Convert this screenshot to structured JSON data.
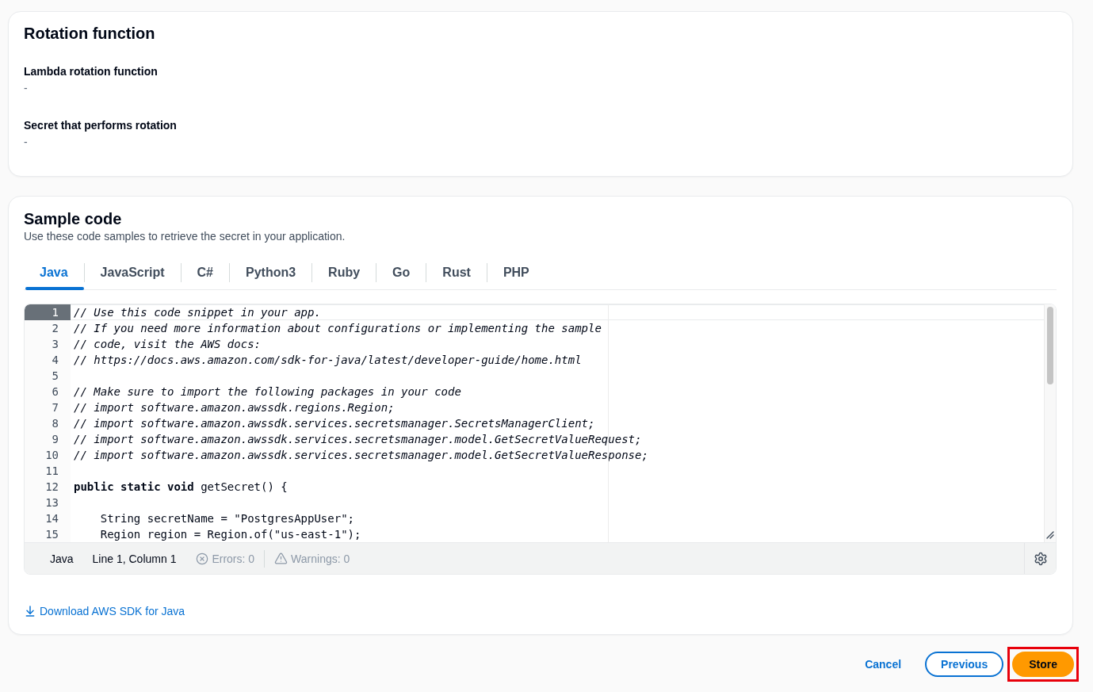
{
  "rotation_function": {
    "title": "Rotation function",
    "fields": [
      {
        "label": "Lambda rotation function",
        "value": "-"
      },
      {
        "label": "Secret that performs rotation",
        "value": "-"
      }
    ]
  },
  "sample_code": {
    "title": "Sample code",
    "description": "Use these code samples to retrieve the secret in your application.",
    "tabs": [
      {
        "label": "Java",
        "selected": true
      },
      {
        "label": "JavaScript",
        "selected": false
      },
      {
        "label": "C#",
        "selected": false
      },
      {
        "label": "Python3",
        "selected": false
      },
      {
        "label": "Ruby",
        "selected": false
      },
      {
        "label": "Go",
        "selected": false
      },
      {
        "label": "Rust",
        "selected": false
      },
      {
        "label": "PHP",
        "selected": false
      }
    ],
    "editor": {
      "lines": [
        {
          "number": "1",
          "kind": "comment",
          "text": "// Use this code snippet in your app.",
          "active": true
        },
        {
          "number": "2",
          "kind": "comment",
          "text": "// If you need more information about configurations or implementing the sample",
          "active": false
        },
        {
          "number": "3",
          "kind": "comment",
          "text": "// code, visit the AWS docs:",
          "active": false
        },
        {
          "number": "4",
          "kind": "comment",
          "text": "// https://docs.aws.amazon.com/sdk-for-java/latest/developer-guide/home.html",
          "active": false
        },
        {
          "number": "5",
          "kind": "blank",
          "active": false
        },
        {
          "number": "6",
          "kind": "comment",
          "text": "// Make sure to import the following packages in your code",
          "active": false
        },
        {
          "number": "7",
          "kind": "comment",
          "text": "// import software.amazon.awssdk.regions.Region;",
          "active": false
        },
        {
          "number": "8",
          "kind": "comment",
          "text": "// import software.amazon.awssdk.services.secretsmanager.SecretsManagerClient;",
          "active": false
        },
        {
          "number": "9",
          "kind": "comment",
          "text": "// import software.amazon.awssdk.services.secretsmanager.model.GetSecretValueRequest;",
          "active": false
        },
        {
          "number": "10",
          "kind": "comment",
          "text": "// import software.amazon.awssdk.services.secretsmanager.model.GetSecretValueResponse;",
          "active": false
        },
        {
          "number": "11",
          "kind": "blank",
          "active": false
        },
        {
          "number": "12",
          "kind": "code",
          "text": "**public static void** getSecret() {",
          "active": false
        },
        {
          "number": "13",
          "kind": "blank",
          "active": false
        },
        {
          "number": "14",
          "kind": "code",
          "text": "    String secretName = \"PostgresAppUser\";",
          "active": false
        },
        {
          "number": "15",
          "kind": "code",
          "text": "    Region region = Region.of(\"us-east-1\");",
          "active": false
        }
      ],
      "status_bar": {
        "language": "Java",
        "position": "Line 1, Column 1",
        "errors": "Errors: 0",
        "warnings": "Warnings: 0"
      }
    },
    "download_link": "Download AWS SDK for Java"
  },
  "footer": {
    "buttons": [
      {
        "label": "Cancel",
        "kind": "link",
        "highlighted": false
      },
      {
        "label": "Previous",
        "kind": "secondary",
        "highlighted": false
      },
      {
        "label": "Store",
        "kind": "primary",
        "highlighted": true
      }
    ]
  }
}
